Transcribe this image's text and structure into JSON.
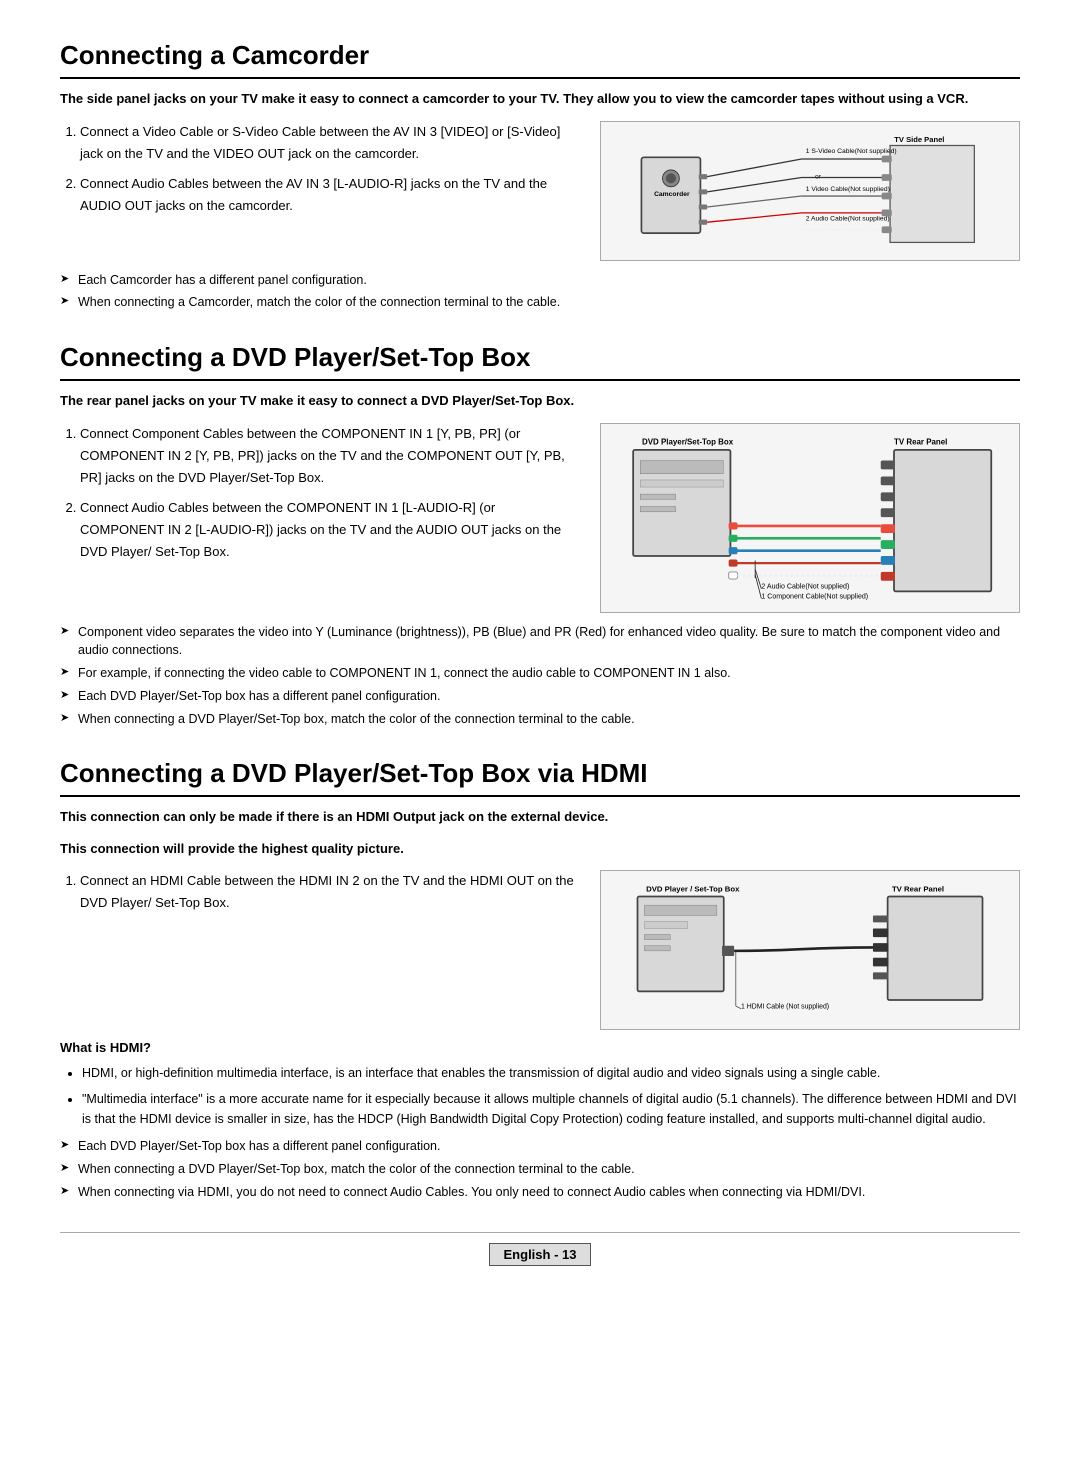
{
  "sections": [
    {
      "id": "camcorder",
      "title": "Connecting a Camcorder",
      "intro": "The side panel jacks on your TV make it easy to connect a camcorder to your TV. They allow you to view the camcorder tapes without using a VCR.",
      "steps": [
        "Connect a Video Cable or S-Video Cable between the AV IN 3 [VIDEO] or [S-Video] jack on the TV and the VIDEO OUT jack on the camcorder.",
        "Connect Audio Cables between the AV IN 3 [L-AUDIO-R] jacks on the TV and the AUDIO OUT jacks on the camcorder."
      ],
      "notes": [
        "Each Camcorder has a different panel configuration.",
        "When connecting a Camcorder, match the color of the connection terminal to the cable."
      ],
      "diagram_labels": {
        "left": "Camcorder",
        "right": "TV Side Panel",
        "cable1": "1  S-Video Cable(Not supplied)",
        "cable2": "1  Video Cable(Not supplied)",
        "cable3": "2  Audio Cable(Not supplied)",
        "or": "or"
      }
    },
    {
      "id": "dvd",
      "title": "Connecting a DVD Player/Set-Top Box",
      "intro": "The rear panel jacks on your TV make it easy to connect a DVD Player/Set-Top Box.",
      "steps": [
        "Connect Component Cables between the COMPONENT IN 1 [Y, PB, PR] (or COMPONENT IN 2 [Y, PB, PR]) jacks on the TV and the COMPONENT OUT [Y, PB, PR] jacks on the DVD Player/Set-Top Box.",
        "Connect Audio Cables between the COMPONENT IN 1 [L-AUDIO-R] (or COMPONENT IN 2 [L-AUDIO-R]) jacks on the TV and the AUDIO OUT jacks on the DVD Player/ Set-Top Box."
      ],
      "notes": [
        "Component video separates the video into Y (Luminance (brightness)), PB (Blue) and PR (Red) for enhanced video quality. Be sure to match the component video and audio connections.",
        "For example, if connecting the video cable to COMPONENT IN 1, connect the audio cable to COMPONENT IN 1 also.",
        "Each DVD Player/Set-Top box has a different panel configuration.",
        "When connecting a DVD Player/Set-Top box, match the color of the connection terminal to the cable."
      ],
      "diagram_labels": {
        "left": "DVD Player/Set-Top Box",
        "right": "TV Rear Panel",
        "cable1": "2  Audio Cable(Not supplied)",
        "cable2": "1  Component Cable(Not supplied)"
      }
    },
    {
      "id": "hdmi",
      "title": "Connecting a DVD Player/Set-Top Box via HDMI",
      "intro1": "This connection can only be made if there is an HDMI Output jack on the external device.",
      "intro2": "This connection will provide the highest quality picture.",
      "steps": [
        "Connect an HDMI Cable between the HDMI IN 2 on the TV and the HDMI OUT on the DVD Player/ Set-Top Box."
      ],
      "diagram_labels": {
        "left": "DVD Player / Set-Top Box",
        "right": "TV Rear Panel",
        "cable1": "1  HDMI Cable (Not supplied)"
      },
      "what_is_hdmi_title": "What is HDMI?",
      "what_is_hdmi_bullets": [
        "HDMI, or high-definition multimedia interface, is an interface that enables the transmission of digital audio and video signals using a single cable.",
        "\"Multimedia interface\" is a more accurate name for it especially because it allows multiple channels of digital audio (5.1 channels). The difference between HDMI and DVI is that the HDMI device is smaller in size, has the HDCP (High Bandwidth Digital Copy Protection) coding feature installed, and supports multi-channel digital audio."
      ],
      "notes": [
        "Each DVD Player/Set-Top box has a different panel configuration.",
        "When connecting a DVD Player/Set-Top box, match the color of the connection terminal to the cable.",
        "When connecting via HDMI, you do not need to connect Audio Cables. You only need to connect Audio cables when connecting via HDMI/DVI."
      ]
    }
  ],
  "footer": {
    "text": "English - 13"
  }
}
